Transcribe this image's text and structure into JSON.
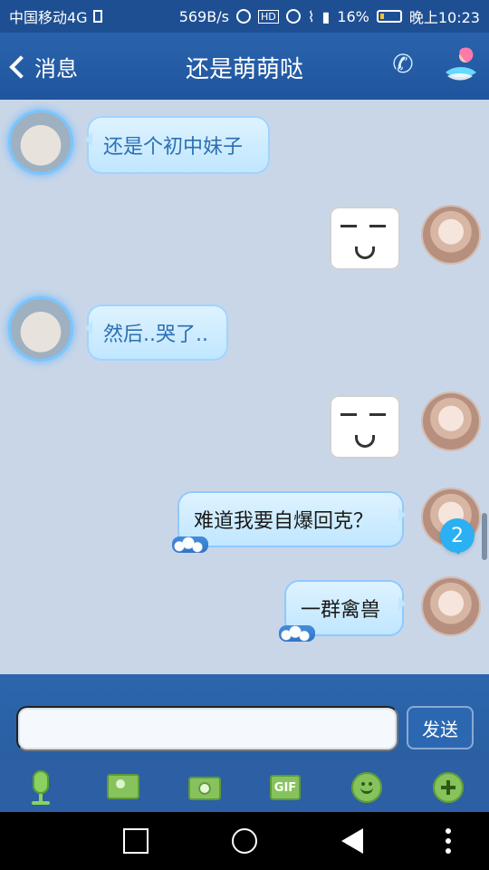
{
  "status_bar": {
    "carrier": "中国移动4G",
    "speed": "569B/s",
    "battery": "16%",
    "time": "晚上10:23"
  },
  "header": {
    "back_label": "消息",
    "title": "还是萌萌哒"
  },
  "messages": [
    {
      "side": "left",
      "type": "text",
      "text": "还是个初中妹子"
    },
    {
      "side": "right",
      "type": "sticker"
    },
    {
      "side": "left",
      "type": "text",
      "text": "然后..哭了.."
    },
    {
      "side": "right",
      "type": "sticker"
    },
    {
      "side": "right",
      "type": "text",
      "text": "难道我要自爆回克？"
    },
    {
      "side": "right",
      "type": "text",
      "text": "一群禽兽"
    }
  ],
  "unread_badge": "2",
  "composer": {
    "input_value": "",
    "send_label": "发送"
  },
  "toolbar": {
    "gif_label": "GIF",
    "icons": [
      "microphone-icon",
      "image-icon",
      "camera-icon",
      "gif-icon",
      "emoji-icon",
      "plus-icon"
    ]
  },
  "colors": {
    "header": "#2a63ac",
    "chat_bg": "#c9d6e8",
    "bubble": "#bfe6ff",
    "accent": "#2ab0f3"
  }
}
